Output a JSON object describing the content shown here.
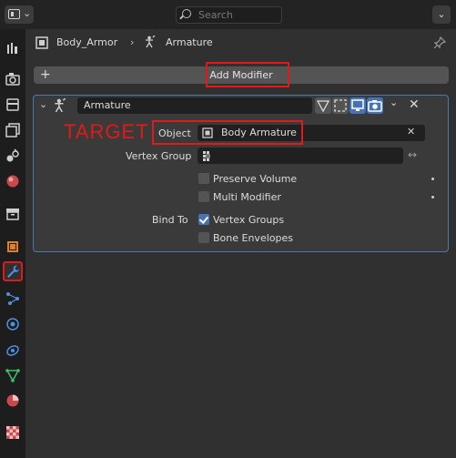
{
  "topbar": {
    "search_placeholder": "Search"
  },
  "breadcrumb": {
    "object": "Body_Armor",
    "modifier": "Armature"
  },
  "add_modifier_label": "Add Modifier",
  "modifier": {
    "name": "Armature",
    "object_label": "Object",
    "object_value": "Body Armature",
    "vertex_group_label": "Vertex Group",
    "vertex_group_value": "",
    "preserve_volume": "Preserve Volume",
    "multi_modifier": "Multi Modifier",
    "bind_to_label": "Bind To",
    "vertex_groups": "Vertex Groups",
    "bone_envelopes": "Bone Envelopes",
    "vertex_groups_checked": true,
    "bone_envelopes_checked": false,
    "preserve_volume_checked": false,
    "multi_modifier_checked": false
  },
  "annotation": {
    "target_label": "TARGET"
  },
  "colors": {
    "highlight": "#e01a1a",
    "accent": "#4772b3",
    "panel_outline": "#4b79ad"
  }
}
